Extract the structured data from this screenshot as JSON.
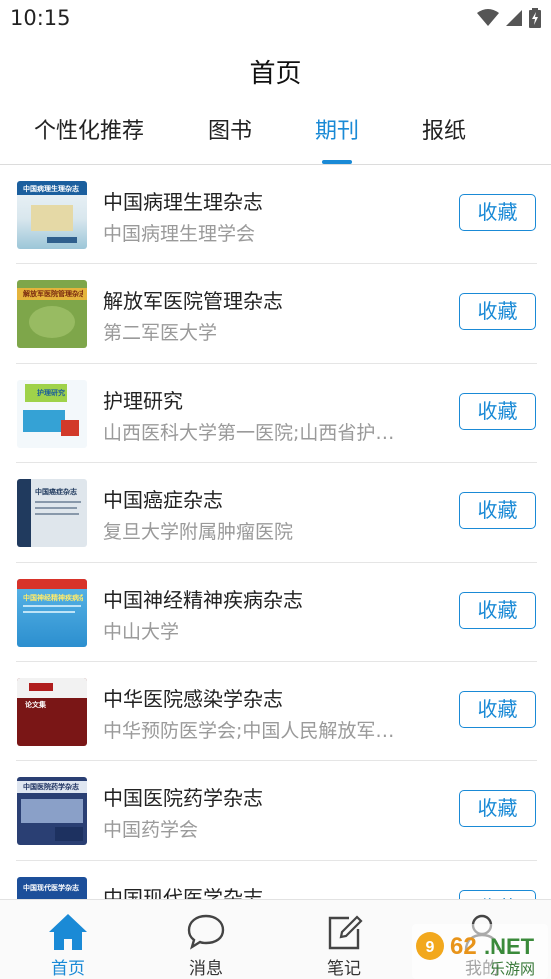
{
  "status_bar": {
    "time": "10:15",
    "wifi_icon": "wifi-icon",
    "signal_icon": "signal-icon",
    "battery_icon": "battery-charging-icon"
  },
  "header": {
    "title": "首页"
  },
  "tabs": [
    {
      "label": "个性化推荐",
      "active": false
    },
    {
      "label": "图书",
      "active": false
    },
    {
      "label": "期刊",
      "active": true
    },
    {
      "label": "报纸",
      "active": false
    }
  ],
  "accent_color": "#1a8ad6",
  "journals": [
    {
      "name": "中国病理生理杂志",
      "publisher": "中国病理生理学会",
      "action": "收藏",
      "cover_text": "中国病理生理杂志"
    },
    {
      "name": "解放军医院管理杂志",
      "publisher": "第二军医大学",
      "action": "收藏",
      "cover_text": "解放军医院管理杂志"
    },
    {
      "name": "护理研究",
      "publisher": "山西医科大学第一医院;山西省护理学会",
      "action": "收藏",
      "cover_text": "护理研究"
    },
    {
      "name": "中国癌症杂志",
      "publisher": "复旦大学附属肿瘤医院",
      "action": "收藏",
      "cover_text": "中国癌症杂志"
    },
    {
      "name": "中国神经精神疾病杂志",
      "publisher": "中山大学",
      "action": "收藏",
      "cover_text": "中国神经精神疾病杂志"
    },
    {
      "name": "中华医院感染学杂志",
      "publisher": "中华预防医学会;中国人民解放军总医院",
      "action": "收藏",
      "cover_text": "论文集"
    },
    {
      "name": "中国医院药学杂志",
      "publisher": "中国药学会",
      "action": "收藏",
      "cover_text": "中国医院药学杂志"
    },
    {
      "name": "中国现代医学杂志",
      "publisher": "",
      "action": "收藏",
      "cover_text": "中国现代医学杂志"
    }
  ],
  "bottom_nav": [
    {
      "label": "首页",
      "icon": "home-icon",
      "active": true
    },
    {
      "label": "消息",
      "icon": "message-icon",
      "active": false
    },
    {
      "label": "笔记",
      "icon": "note-edit-icon",
      "active": false
    },
    {
      "label": "我的",
      "icon": "user-icon",
      "active": false
    }
  ],
  "watermark": {
    "site": "962.NET",
    "subtitle": "乐游网"
  }
}
